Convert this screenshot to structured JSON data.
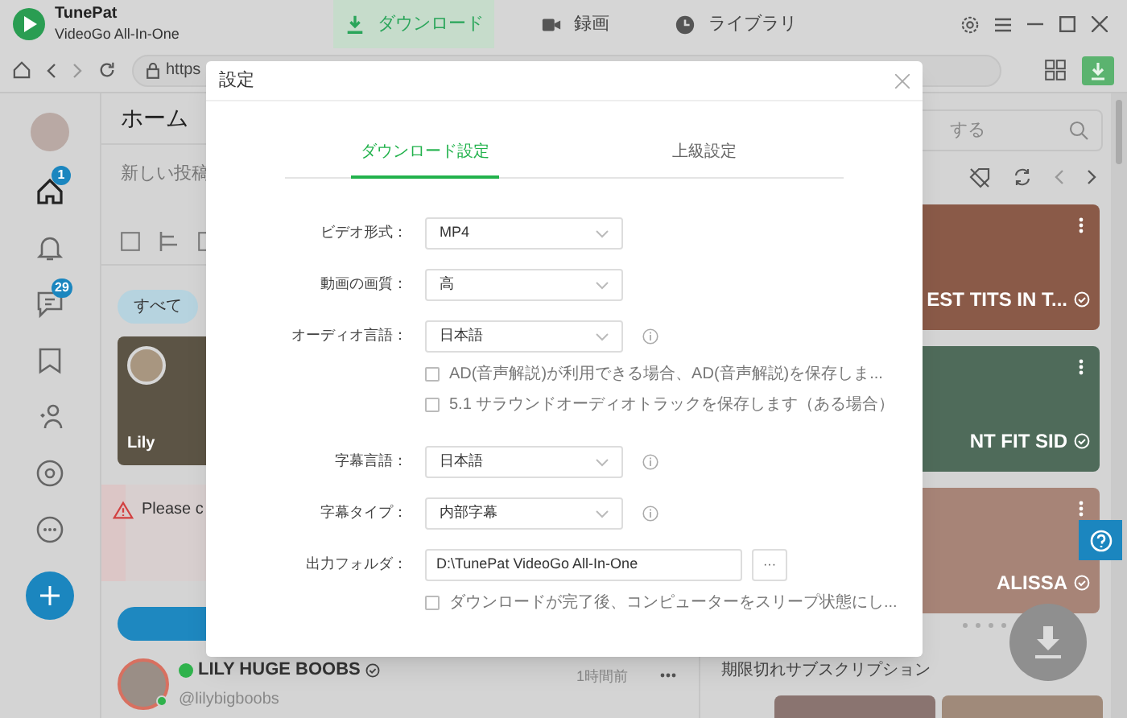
{
  "app": {
    "name": "TunePat",
    "subtitle": "VideoGo All-In-One"
  },
  "nav_tabs": [
    {
      "label": "ダウンロード",
      "selected": true
    },
    {
      "label": "録画",
      "selected": false
    },
    {
      "label": "ライブラリ",
      "selected": false
    }
  ],
  "address_bar": {
    "url": "https"
  },
  "sidebar": {
    "items": [
      {
        "badge": "1",
        "selected": true
      },
      {
        "selected": false
      },
      {
        "badge": "29",
        "selected": false
      },
      {
        "selected": false
      },
      {
        "selected": false
      },
      {
        "selected": false
      },
      {
        "selected": false
      }
    ]
  },
  "feed": {
    "title": "ホーム",
    "composer_placeholder": "新しい投稿",
    "filter_chip": "すべて",
    "story": {
      "name": "Lily"
    },
    "warning": "Please c",
    "post": {
      "name": "LILY HUGE BOOBS",
      "online": true,
      "handle": "@lilybigboobs",
      "time": "1時間前"
    }
  },
  "right_panel": {
    "search_placeholder": "する",
    "cards": [
      {
        "caption": "EST TITS IN T..."
      },
      {
        "caption": "NT FIT SID"
      },
      {
        "caption": "ALISSA"
      }
    ],
    "section_title": "期限切れサブスクリプション"
  },
  "dialog": {
    "title": "設定",
    "tabs": [
      {
        "label": "ダウンロード設定",
        "selected": true
      },
      {
        "label": "上級設定",
        "selected": false
      }
    ],
    "fields": [
      {
        "kind": "select",
        "label": "ビデオ形式：",
        "value": "MP4",
        "info": false
      },
      {
        "kind": "select",
        "label": "動画の画質：",
        "value": "高",
        "info": false
      },
      {
        "kind": "select",
        "label": "オーディオ言語：",
        "value": "日本語",
        "info": true
      },
      {
        "kind": "checkbox",
        "label": "AD(音声解説)が利用できる場合、AD(音声解説)を保存しま...",
        "checked": false
      },
      {
        "kind": "checkbox",
        "label": "5.1 サラウンドオーディオトラックを保存します（ある場合）",
        "checked": false
      },
      {
        "kind": "select",
        "label": "字幕言語：",
        "value": "日本語",
        "info": true
      },
      {
        "kind": "select",
        "label": "字幕タイプ：",
        "value": "内部字幕",
        "info": true
      },
      {
        "kind": "folder",
        "label": "出力フォルダ：",
        "value": "D:\\TunePat VideoGo All-In-One",
        "button": "···"
      },
      {
        "kind": "checkbox",
        "label": "ダウンロードが完了後、コンピューターをスリープ状態にし...",
        "checked": false
      }
    ]
  }
}
